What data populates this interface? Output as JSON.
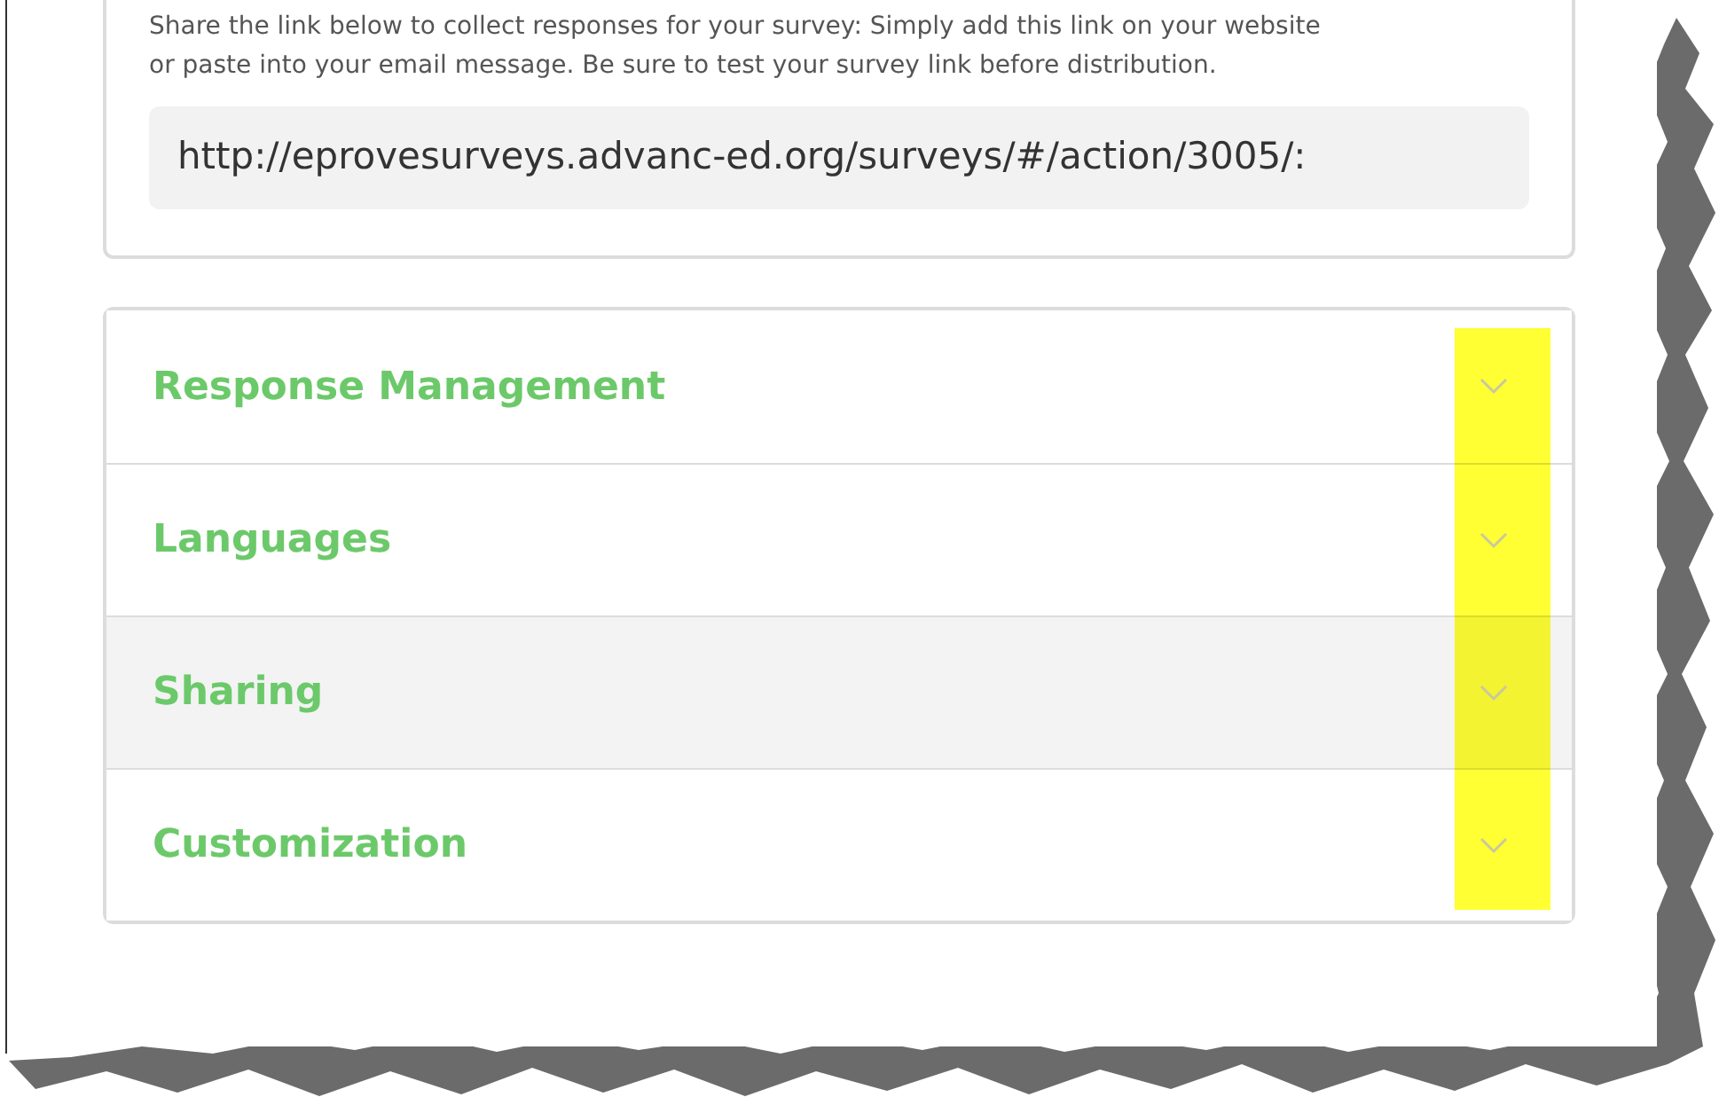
{
  "share_card": {
    "description": "Share the link below to collect responses for your survey: Simply add this link on your website or paste into your email message. Be sure to test your survey link before distribution.",
    "link_value": "http://eprovesurveys.advanc-ed.org/surveys/#/action/3005/:"
  },
  "accordion": [
    {
      "title": "Response Management",
      "expanded": false,
      "highlighted": false
    },
    {
      "title": "Languages",
      "expanded": false,
      "highlighted": false
    },
    {
      "title": "Sharing",
      "expanded": false,
      "highlighted": true
    },
    {
      "title": "Customization",
      "expanded": false,
      "highlighted": false
    }
  ],
  "annotation": {
    "kind": "highlight",
    "color": "#ffff33"
  }
}
